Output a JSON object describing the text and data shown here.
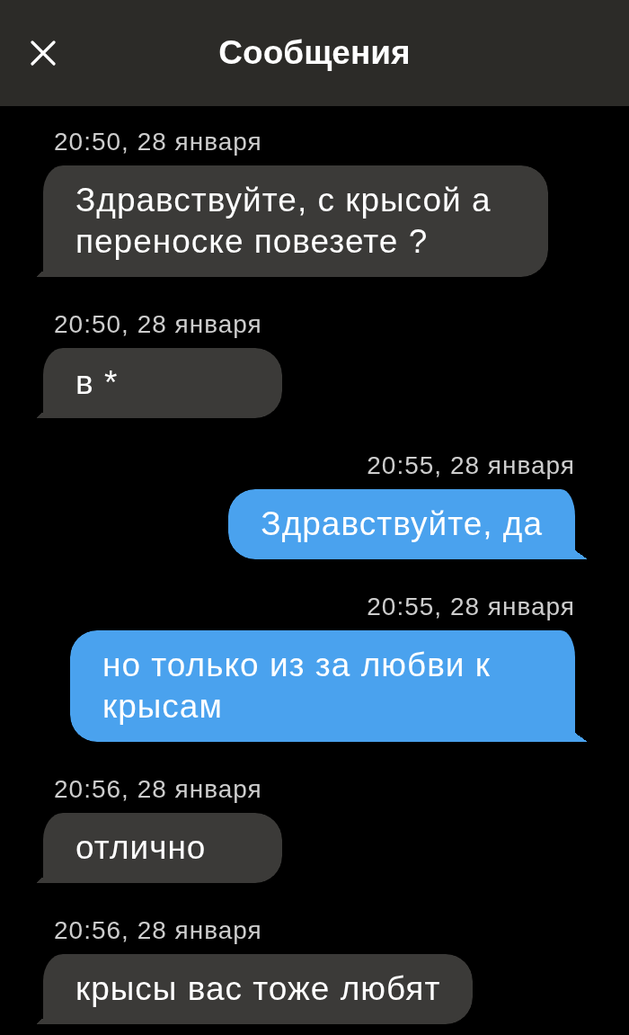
{
  "header": {
    "title": "Сообщения"
  },
  "messages": [
    {
      "kind": "incoming",
      "time": "20:50, 28 января",
      "text": "Здравствуйте, с крысой а переноске повезете ?"
    },
    {
      "kind": "incoming",
      "time": "20:50, 28 января",
      "text": "в *"
    },
    {
      "kind": "outgoing",
      "time": "20:55, 28 января",
      "text": "Здравствуйте, да"
    },
    {
      "kind": "outgoing",
      "time": "20:55, 28 января",
      "text": "но только из за любви к крысам"
    },
    {
      "kind": "incoming",
      "time": "20:56, 28 января",
      "text": "отлично"
    },
    {
      "kind": "incoming",
      "time": "20:56, 28 января",
      "text": "крысы вас тоже любят"
    }
  ]
}
